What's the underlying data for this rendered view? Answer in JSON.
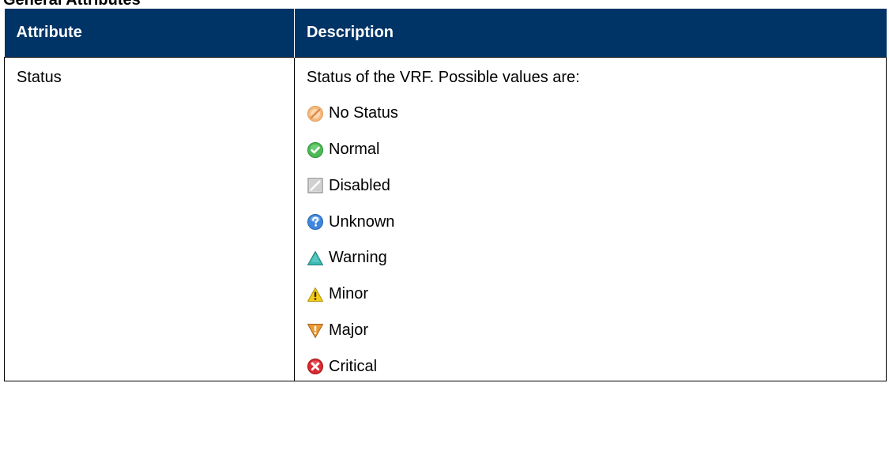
{
  "section_title": "General Attributes",
  "table": {
    "headers": {
      "attribute": "Attribute",
      "description": "Description"
    },
    "rows": [
      {
        "attribute": "Status",
        "description_intro": "Status of the VRF. Possible values are:",
        "values": [
          {
            "label": "No Status",
            "icon": "no-status-icon",
            "color": "#f0a868"
          },
          {
            "label": "Normal",
            "icon": "normal-check-icon",
            "color": "#3fae49"
          },
          {
            "label": "Disabled",
            "icon": "disabled-icon",
            "color": "#b0b0b0"
          },
          {
            "label": "Unknown",
            "icon": "unknown-question-icon",
            "color": "#3a7fd5"
          },
          {
            "label": "Warning",
            "icon": "warning-triangle-icon",
            "color": "#38b5b0"
          },
          {
            "label": "Minor",
            "icon": "minor-alert-icon",
            "color": "#f2c811"
          },
          {
            "label": "Major",
            "icon": "major-alert-icon",
            "color": "#e8902a"
          },
          {
            "label": "Critical",
            "icon": "critical-x-icon",
            "color": "#d8262c"
          }
        ]
      }
    ]
  },
  "colors": {
    "header_background": "#003366",
    "header_text": "#ffffff",
    "border": "#000000"
  }
}
